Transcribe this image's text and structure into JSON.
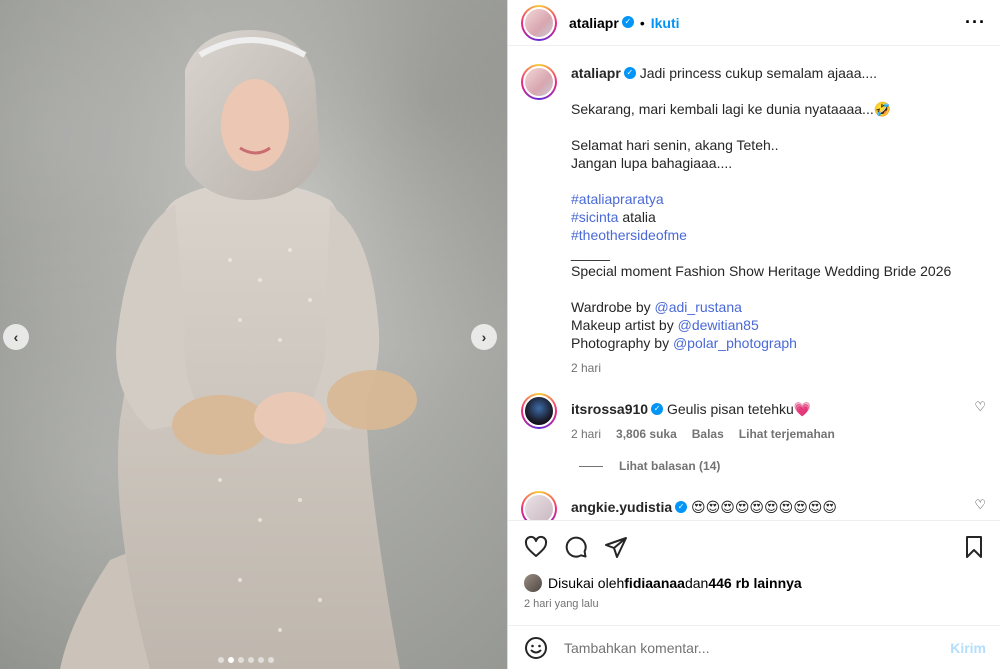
{
  "post": {
    "username": "ataliapr",
    "follow_label": "Ikuti",
    "header_separator": "•",
    "more_icon": "more-horizontal-icon",
    "caption_lines": [
      "Jadi princess cukup semalam ajaaa....",
      "",
      "Sekarang, mari kembali lagi ke dunia nyataaaa...🤣",
      "",
      "Selamat hari senin, akang Teteh..",
      "Jangan lupa bahagiaaa....",
      ""
    ],
    "hashtag1": "#ataliapraratya",
    "hashtag2": "#sicinta",
    "hashtag2_suffix": " atalia",
    "hashtag3": "#theothersideofme",
    "divider_line": "_____",
    "special_line": "Special moment Fashion Show Heritage Wedding Bride 2026",
    "wardrobe_prefix": "Wardrobe by ",
    "wardrobe_handle": "@adi_rustana",
    "makeup_prefix": "Makeup artist by ",
    "makeup_handle": "@dewitian85",
    "photo_prefix": "Photography by ",
    "photo_handle": "@polar_photograph",
    "caption_time": "2 hari"
  },
  "comments": [
    {
      "username": "itsrossa910",
      "text": "Geulis pisan tetehku💗",
      "time": "2 hari",
      "likes": "3,806 suka",
      "reply_label": "Balas",
      "translate_label": "Lihat terjemahan",
      "view_replies": "Lihat balasan (14)"
    },
    {
      "username": "angkie.yudistia",
      "text": "😍😍😍😍😍😍😍😍😍😍"
    }
  ],
  "likes": {
    "prefix": "Disukai oleh ",
    "user": "fidiaanaa",
    "middle": " dan ",
    "count": "446 rb lainnya"
  },
  "post_date": "2 hari yang lalu",
  "comment_box": {
    "placeholder": "Tambahkan komentar...",
    "post_label": "Kirim"
  },
  "media": {
    "prev_icon": "‹",
    "next_icon": "›",
    "slide_count": 6,
    "active_slide": 2
  },
  "colors": {
    "link": "#4a69d6",
    "follow": "#0095f6",
    "verified": "#0095f6",
    "heart": "#ed4956"
  }
}
